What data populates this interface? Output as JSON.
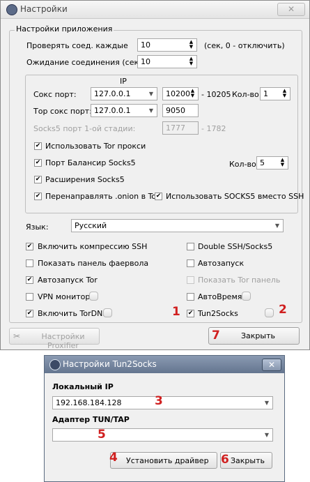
{
  "main_window": {
    "title": "Настройки",
    "close_label": "✕",
    "app_group_title": "Настройки приложения",
    "check_conn_label": "Проверять соед. каждые",
    "check_conn_value": "10",
    "check_conn_hint": "(сек, 0 - отключить)",
    "wait_conn_label": "Ожидание соединения (сек)",
    "wait_conn_value": "10",
    "ip_header": "IP",
    "socks_port_label": "Сокс порт:",
    "socks_ip": "127.0.0.1",
    "socks_port": "10200",
    "socks_port_end": "- 10205",
    "count_label": "Кол-во:",
    "socks_count": "1",
    "tor_socks_label": "Тор сокс порт:",
    "tor_ip": "127.0.0.1",
    "tor_port": "9050",
    "socks5_stage1_label": "Socks5 порт 1-ой стадии:",
    "socks5_stage1_port": "1777",
    "socks5_stage1_end": "- 1782",
    "use_tor_proxy": "Использовать Tor прокси",
    "balancer_port": "Порт Балансир Socks5",
    "balancer_count_label": "Кол-во:",
    "balancer_count": "5",
    "socks5_ext": "Расширения Socks5",
    "redirect_onion": "Перенаправлять .onion в Tor",
    "use_socks5_instead_ssh": "Использовать SOCKS5 вместо SSH",
    "language_label": "Язык:",
    "language_value": "Русский",
    "ssh_compression": "Включить компрессию SSH",
    "double_ssh": "Double SSH/Socks5",
    "show_firewall": "Показать панель фаервола",
    "autostart": "Автозапуск",
    "autostart_tor": "Автозапуск Tor",
    "show_tor_panel": "Показать Tor панель",
    "vpn_monitor": "VPN монитор",
    "autotime": "АвтоВремя",
    "enable_tordns": "Включить TorDNS",
    "tun2socks": "Tun2Socks",
    "proxifier_button": "Настройки Proxifier",
    "close_button": "Закрыть"
  },
  "tun_window": {
    "title": "Настройки Tun2Socks",
    "close_label": "✕",
    "local_ip_label": "Локальный IP",
    "local_ip_value": "192.168.184.128",
    "adapter_label": "Адаптер TUN/TAP",
    "adapter_value": "",
    "install_driver_button": "Установить драйвер",
    "close_button": "Закрыть"
  },
  "annotations": {
    "n1": "1",
    "n2": "2",
    "n3": "3",
    "n4": "4",
    "n5": "5",
    "n6": "6",
    "n7": "7"
  }
}
